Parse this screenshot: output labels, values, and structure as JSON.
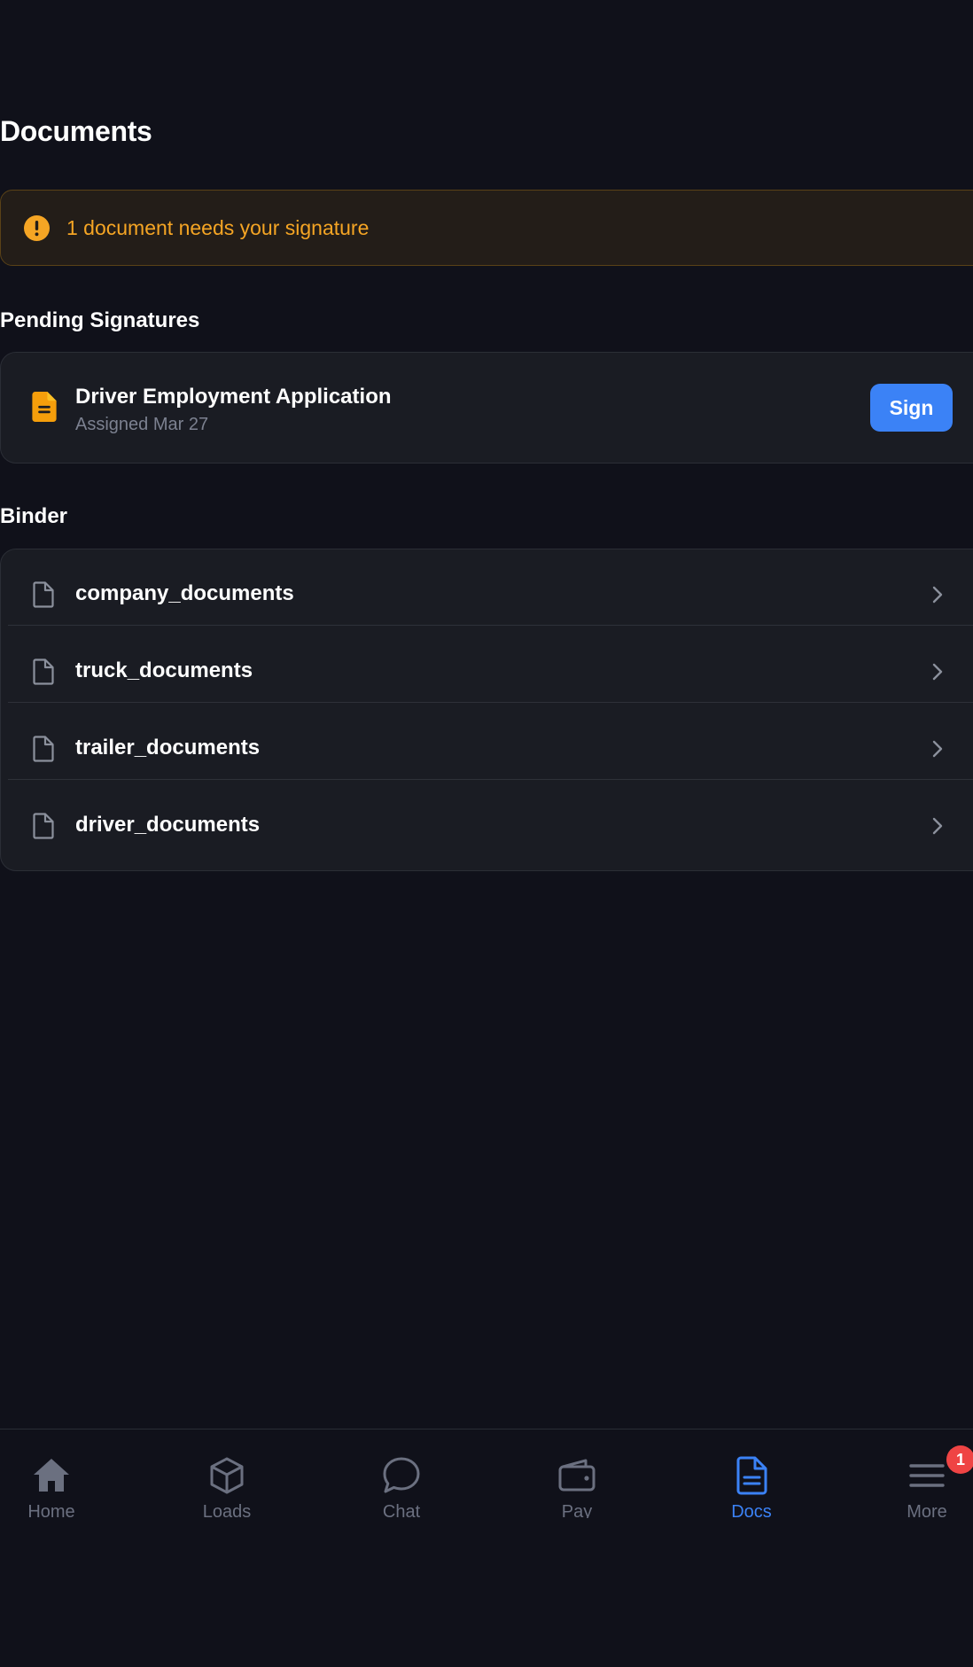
{
  "page": {
    "title": "Documents"
  },
  "alert": {
    "text": "1 document needs your signature",
    "icon": "exclamation-circle-icon",
    "color": "#f5a524"
  },
  "pending": {
    "heading": "Pending Signatures",
    "items": [
      {
        "title": "Driver Employment Application",
        "subtitle": "Assigned Mar 27",
        "action_label": "Sign",
        "icon": "document-text-icon"
      }
    ]
  },
  "binder": {
    "heading": "Binder",
    "items": [
      {
        "label": "company_documents",
        "icon": "document-icon"
      },
      {
        "label": "truck_documents",
        "icon": "document-icon"
      },
      {
        "label": "trailer_documents",
        "icon": "document-icon"
      },
      {
        "label": "driver_documents",
        "icon": "document-icon"
      }
    ]
  },
  "bottom_nav": {
    "active": "Docs",
    "items": [
      {
        "label": "Home",
        "icon": "home-icon"
      },
      {
        "label": "Loads",
        "icon": "cube-icon"
      },
      {
        "label": "Chat",
        "icon": "chat-bubble-icon"
      },
      {
        "label": "Pay",
        "icon": "wallet-icon"
      },
      {
        "label": "Docs",
        "icon": "document-text-icon"
      },
      {
        "label": "More",
        "icon": "menu-icon",
        "badge": "1"
      }
    ]
  },
  "colors": {
    "background": "#10111a",
    "card": "#1a1c23",
    "accent": "#3b82f6",
    "warning": "#f5a524",
    "badge": "#ef4444"
  }
}
